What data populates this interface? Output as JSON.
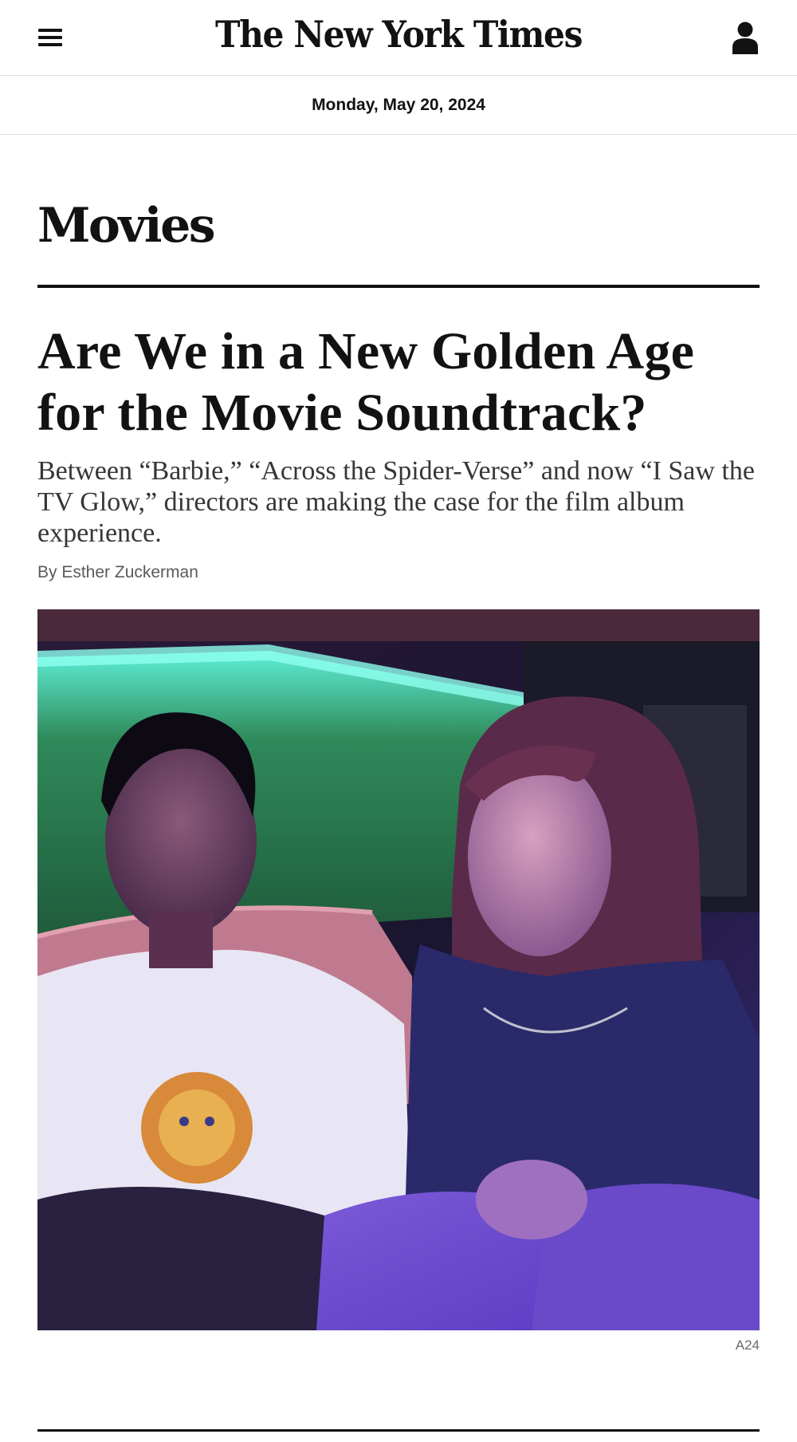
{
  "header": {
    "masthead": "The New York Times",
    "menu_icon": "hamburger-menu-icon",
    "user_icon": "user-account-icon"
  },
  "date": "Monday, May 20, 2024",
  "section": "Movies",
  "article": {
    "headline": "Are We in a New Golden Age for the Movie Soundtrack?",
    "summary": "Between “Barbie,” “Across the Spider-Verse” and now “I Saw the TV Glow,” directors are making the case for the film album experience.",
    "byline": "By Esther Zuckerman",
    "image_credit": "A24"
  },
  "colors": {
    "text": "#121212",
    "rule": "#121212",
    "dek": "#363636",
    "byline": "#5a5a5a"
  }
}
